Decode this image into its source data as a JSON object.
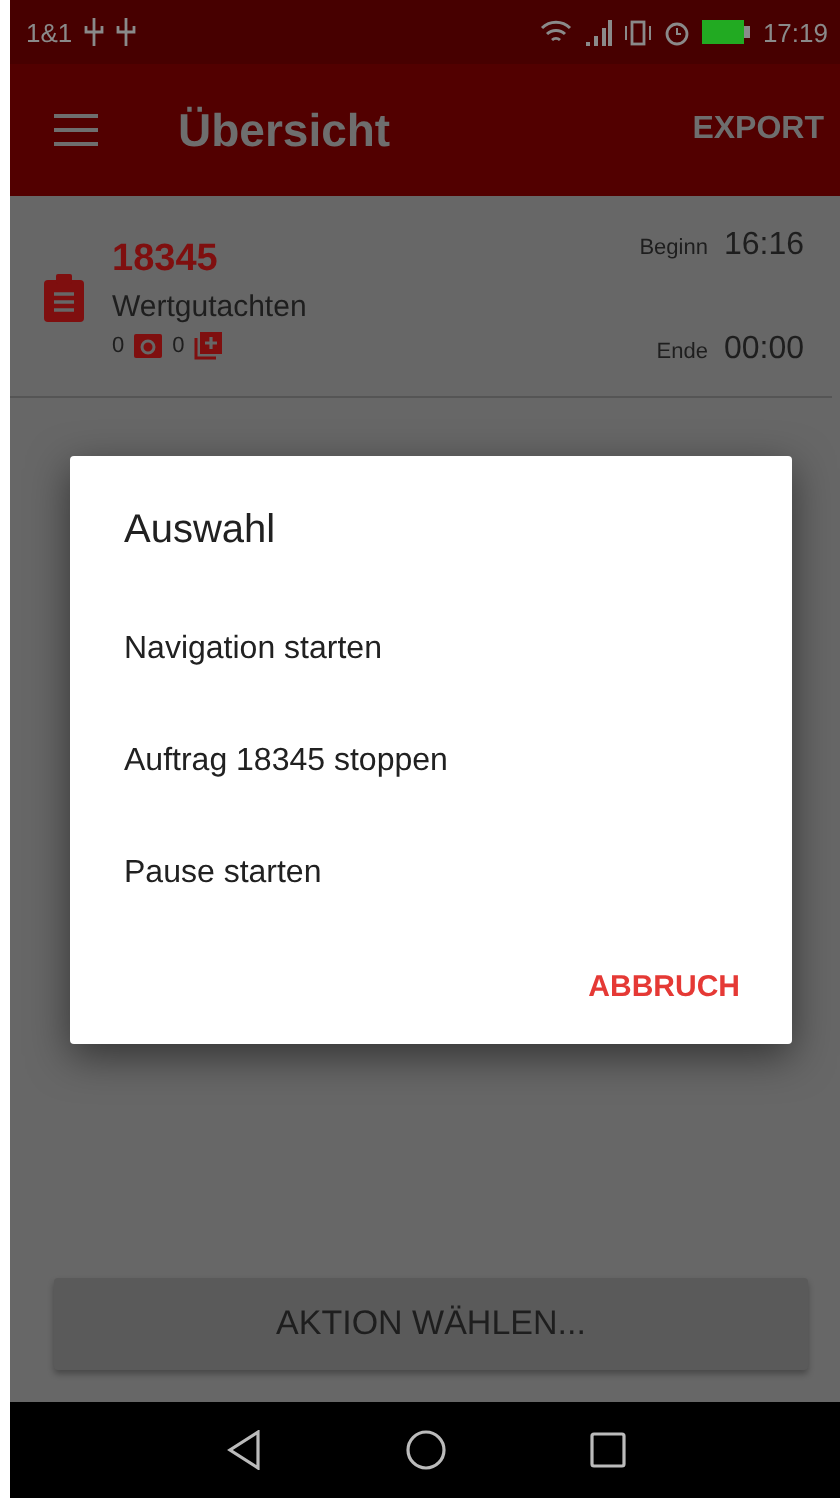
{
  "status_bar": {
    "carrier": "1&1",
    "time": "17:19"
  },
  "app_bar": {
    "title": "Übersicht",
    "action": "EXPORT"
  },
  "order": {
    "number": "18345",
    "type": "Wertgutachten",
    "photo_count": "0",
    "attachment_count": "0",
    "start_label": "Beginn",
    "start_time": "16:16",
    "end_label": "Ende",
    "end_time": "00:00"
  },
  "dialog": {
    "title": "Auswahl",
    "options": [
      "Navigation starten",
      "Auftrag 18345 stoppen",
      "Pause starten"
    ],
    "cancel": "ABBRUCH"
  },
  "action_button": "AKTION WÄHLEN..."
}
